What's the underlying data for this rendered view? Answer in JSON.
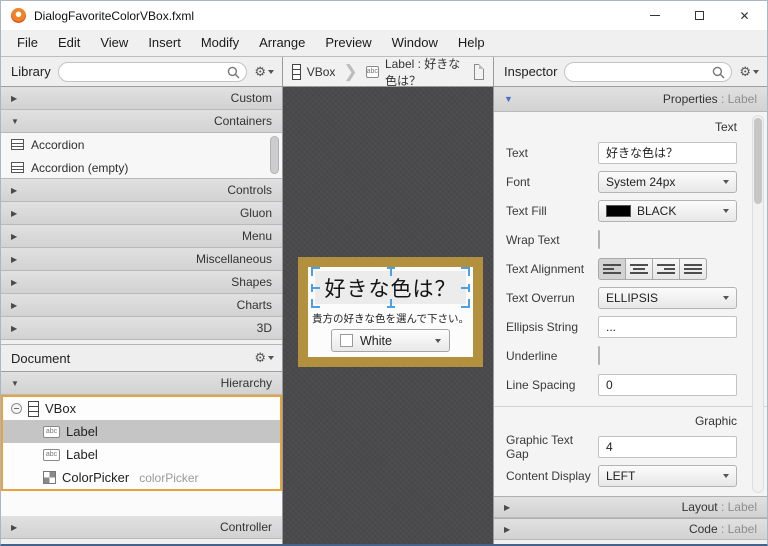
{
  "colors": {
    "accent_orange": "#E8A33D",
    "selection_blue": "#4D9FE8",
    "dialog_frame": "#B2903E",
    "canvas_bg": "#4A4A4C",
    "properties_arrow_blue": "#4472C4",
    "text_fill_swatch": "#000000",
    "colorpicker_swatch": "#FFFFFF"
  },
  "icons": {
    "gear": "⚙",
    "abc": "abc",
    "chevron": "❯",
    "section_collapsed": "▶",
    "section_expanded": "▼",
    "close": "✕"
  },
  "window": {
    "title": "DialogFavoriteColorVBox.fxml"
  },
  "menu": {
    "items": [
      "File",
      "Edit",
      "View",
      "Insert",
      "Modify",
      "Arrange",
      "Preview",
      "Window",
      "Help"
    ]
  },
  "library": {
    "title": "Library",
    "search_placeholder": "",
    "sections": {
      "custom": "Custom",
      "containers": "Containers",
      "controls": "Controls",
      "gluon": "Gluon",
      "menu": "Menu",
      "miscellaneous": "Miscellaneous",
      "shapes": "Shapes",
      "charts": "Charts",
      "threed": "3D"
    },
    "container_items": [
      "Accordion",
      "Accordion  (empty)"
    ]
  },
  "document": {
    "title": "Document",
    "hierarchy_label": "Hierarchy",
    "controller_label": "Controller",
    "tree": [
      {
        "label": "VBox"
      },
      {
        "label": "Label"
      },
      {
        "label": "Label"
      },
      {
        "label": "ColorPicker",
        "fxid": "colorPicker"
      }
    ]
  },
  "canvas": {
    "breadcrumb": {
      "vbox": "VBox",
      "label": "Label : 好きな色は？"
    },
    "dialog": {
      "title": "好きな色は？",
      "subtitle": "貴方の好きな色を選んで下さい。",
      "colorpicker_value": "White"
    }
  },
  "inspector": {
    "title": "Inspector",
    "search_placeholder": "",
    "properties_header": "Properties",
    "properties_target": " : Label",
    "subsections": {
      "text": "Text",
      "graphic": "Graphic"
    },
    "rows": [
      {
        "label": "Text",
        "value": "好きな色は？"
      },
      {
        "label": "Font",
        "value": "System 24px"
      },
      {
        "label": "Text Fill",
        "value": "BLACK"
      },
      {
        "label": "Wrap Text"
      },
      {
        "label": "Text Alignment"
      },
      {
        "label": "Text Overrun",
        "value": "ELLIPSIS"
      },
      {
        "label": "Ellipsis String",
        "value": "..."
      },
      {
        "label": "Underline"
      },
      {
        "label": "Line Spacing",
        "value": "0"
      },
      {
        "label": "Graphic Text Gap",
        "value": "4"
      },
      {
        "label": "Content Display",
        "value": "LEFT"
      }
    ],
    "layout_header": "Layout",
    "layout_target": " : Label",
    "code_header": "Code",
    "code_target": " : Label"
  }
}
